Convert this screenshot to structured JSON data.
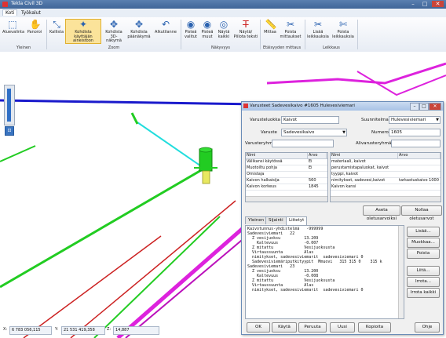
{
  "window": {
    "title": "Tekla Civil 3D"
  },
  "menu": {
    "tab_home": "Koti",
    "tab_tools": "Työkalut"
  },
  "ribbon": {
    "select": "Aluevalinta",
    "pan": "Panoroi",
    "tilt": "Kallista",
    "focus_button": [
      "Kohdista käyttäjän",
      "aineistoon"
    ],
    "focus_3d": [
      "Kohdista 3D-",
      "näkymä"
    ],
    "focus_main": [
      "Kohdista",
      "päänäkymä"
    ],
    "initial": "Alkutilanne",
    "group_general": "Yleinen",
    "group_zoom": "Zoom",
    "points_selected": [
      "Pisteä",
      "valitut"
    ],
    "points_others": [
      "Pisteä",
      "muut"
    ],
    "show_all": [
      "Näytä",
      "kaikki"
    ],
    "show_hide_text": [
      "Näytä/",
      "Piilota teksti"
    ],
    "group_visibility": "Näkyvyys",
    "measure": "Mittaa",
    "remove_measures": [
      "Poista",
      "mittaukset"
    ],
    "group_distance": "Etäisyyden mittaus",
    "add_cutpoints": [
      "Lisää",
      "leikkauksia"
    ],
    "remove_cutpoints": [
      "Poista",
      "leikkauksia"
    ],
    "group_cuts": "Leikkaus"
  },
  "coords": {
    "x_label": "X:",
    "x_value": "6 783 056,115",
    "y_label": "Y:",
    "y_value": "21 531 419,358",
    "z_label": "Z:",
    "z_value": "14,887"
  },
  "dialog": {
    "title": "Varusteet Sadevesikaivo #1605  Hulevesiviemari",
    "class_label": "Varusteluokka",
    "class_value": "Kaivot",
    "plan_label": "Suunnitelma",
    "plan_value": "Hulevesiviemari",
    "type_label": "Varuste",
    "type_value": "Sadevesikaivo",
    "number_label": "Numero",
    "number_value": "1605",
    "group_label": "Varusteryhmä",
    "group_value": "",
    "subgroup_label": "Alivarusteryhmät",
    "subgroup_value": "",
    "left_table": {
      "headers": [
        "Nimi",
        "Arvo"
      ],
      "rows": [
        [
          "Välikansi käytössä",
          "Ei"
        ],
        [
          "Muotoiltu pohja",
          "Ei"
        ],
        [
          "Omistaja",
          ""
        ],
        [
          "Kaivon halkaisija",
          "560"
        ],
        [
          "Kaivon korkeus",
          "1845"
        ]
      ]
    },
    "right_table": {
      "headers": [
        "Nimi",
        "Arvo"
      ],
      "rows": [
        [
          "materiaali, kaivot",
          ""
        ],
        [
          "perustamistapaluokat, kaivot",
          ""
        ],
        [
          "tyyppi, kaivot",
          ""
        ],
        [
          "nimitykset, sadevesi,kaivot",
          "tarkastuskaivo 1000"
        ],
        [
          "Kaivon kansi",
          ""
        ]
      ]
    },
    "set_defaults": "Aseta oletusarvoiksi",
    "load_defaults": "Nollaa oletusarvot",
    "tabs": [
      "Yleinen",
      "Sijainti",
      "Liitetyt"
    ],
    "text_lines": [
      "Kaivotunnus-yhdistelmä   -999999",
      "Sadevesiviemari   22",
      "  Z vesijuoksu          13.209",
      "    Kaltevuus           -0.007",
      "  Z mitattu             Vesijuoksusta",
      "  Virtaussuunta         Alas",
      "  nimitykset, sadevesiviemarit  sadevesiviemari 0",
      "  Sadevesiviemäriputkityypit  Mmuovi   315 315 0    315 k",
      "Sadevesiviemari   23",
      "  Z vesijuoksu          13.200",
      "    Kaltevuus           -0.008",
      "  Z mitattu             Vesijuoksusta",
      "  Virtaussuunta         Alas",
      "  nimitykset, sadevesiviemarit  sadevesiviemari 0"
    ],
    "side_buttons": [
      "Lisää...",
      "Muokkaa...",
      "Poista",
      "Liitä...",
      "Irrota...",
      "Irrota kaikki"
    ],
    "bottom_buttons": [
      "OK",
      "Käytä",
      "Peruuta",
      "Uusi",
      "Kopioita",
      "Ohje"
    ]
  },
  "colors": {
    "accent": "#2a62b0",
    "road_green": "#22cc22",
    "pipe_magenta": "#dd22dd",
    "blue_line": "#1a1acc",
    "cyan": "#22dddd",
    "red": "#cc2222"
  }
}
